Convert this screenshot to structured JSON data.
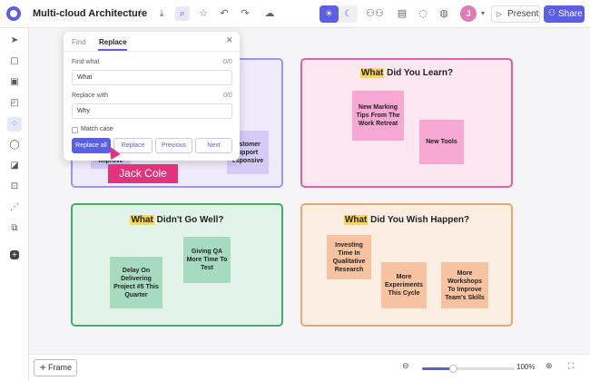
{
  "header": {
    "title": "Multi-cloud Architecture",
    "present_label": "Present",
    "share_label": "Share",
    "avatar_initial": "J",
    "toolbar_icons": [
      "more-options-icon",
      "download-icon",
      "search-icon",
      "star-icon",
      "undo-icon",
      "redo-icon",
      "cloud-icon",
      "sun-icon",
      "moon-icon",
      "collaborators-icon",
      "chart-icon",
      "comment-icon",
      "chat-icon",
      "share-arrow-icon",
      "chevron-down-icon"
    ]
  },
  "sidebar": {
    "icons": [
      "cursor-icon",
      "layout-icon",
      "template-icon",
      "shape-icon",
      "apps-icon",
      "comment-icon",
      "sticky-note-icon",
      "frame-icon",
      "connector-icon",
      "integrations-icon",
      "more-icon"
    ]
  },
  "find_replace": {
    "tab_find": "Find",
    "tab_replace": "Replace",
    "find_label": "Find what",
    "find_count": "0/0",
    "find_value": "What",
    "replace_label": "Replace with",
    "replace_count": "0/0",
    "replace_value": "Why",
    "match_case_label": "Match case",
    "match_case_checked": false,
    "buttons": {
      "replace_all": "Replace all",
      "replace": "Replace",
      "previous": "Previous",
      "next": "Next"
    }
  },
  "cursor_user": "Jack Cole",
  "frames": {
    "learn": {
      "title_highlight": "What",
      "title_rest": " Did You Learn?",
      "stickies": [
        "New Marking Tips From The Work Retreat",
        "New Tools"
      ]
    },
    "went_well": {
      "partial_stickies": [
        "Improve",
        "ustomer upport esponsive"
      ]
    },
    "wrong": {
      "title_highlight": "What",
      "title_rest": " Didn't Go Well?",
      "stickies": [
        "Delay On Delivering Project #5 This Quarter",
        "Giving QA More Time To Test"
      ]
    },
    "wish": {
      "title_highlight": "What",
      "title_rest": " Did You Wish Happen?",
      "stickies": [
        "Investing Time In Qualitative Research",
        "More Experiments This Cycle",
        "More Workshops To Improve Team's Skills"
      ]
    }
  },
  "bottom": {
    "frame_button": "Frame",
    "zoom_value": "100%",
    "zoom_fraction": 0.33
  },
  "colors": {
    "accent": "#5b5fe3",
    "highlight": "#ffd93b",
    "cursor": "#e0357d"
  }
}
